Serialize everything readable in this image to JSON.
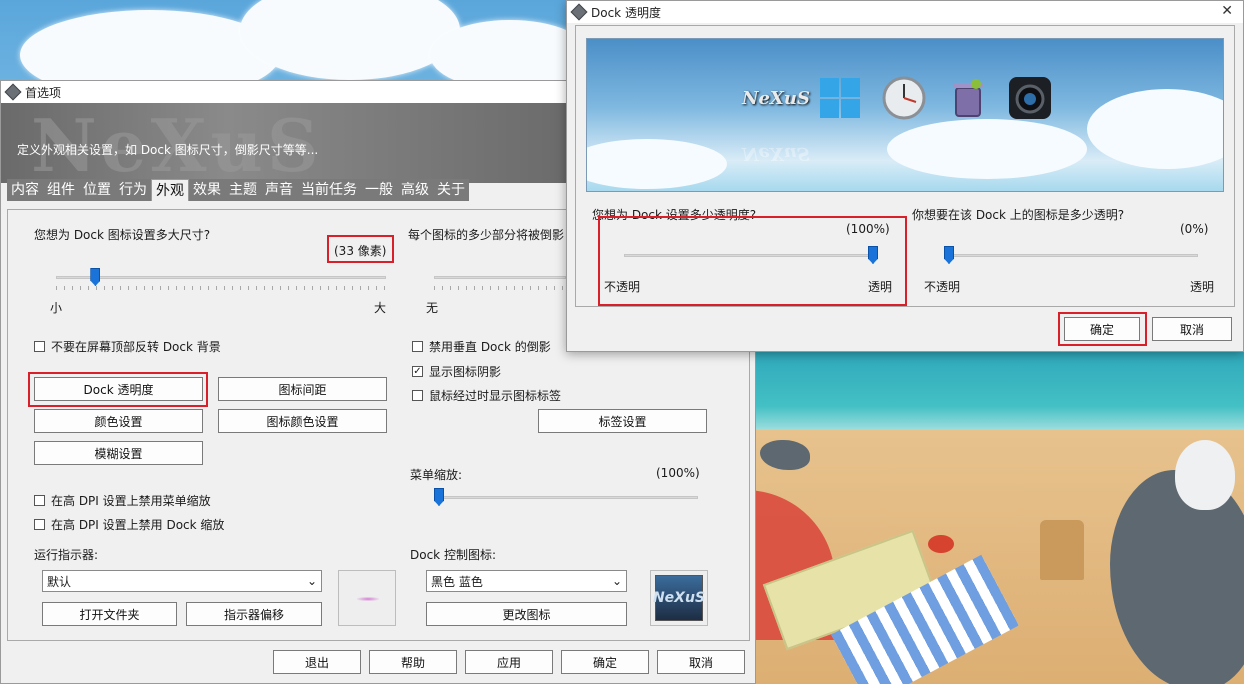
{
  "prefs": {
    "title": "首选项",
    "banner_logo": "NeXuS",
    "banner_text": "定义外观相关设置，如 Dock 图标尺寸，倒影尺寸等等...",
    "tabs": [
      "内容",
      "组件",
      "位置",
      "行为",
      "外观",
      "效果",
      "主题",
      "声音",
      "当前任务",
      "一般",
      "高级",
      "关于"
    ],
    "active_tab": "外观",
    "icon_size_question": "您想为 Dock 图标设置多大尺寸?",
    "icon_size_value": "(33 像素)",
    "icon_size_level": 0.12,
    "slider_min": "小",
    "slider_max": "大",
    "reflection_question": "每个图标的多少部分将被倒影",
    "reflection_min": "无",
    "chk_no_flip": "不要在屏幕顶部反转 Dock 背景",
    "btn_dock_transparency": "Dock 透明度",
    "btn_icon_spacing": "图标间距",
    "btn_color_settings": "颜色设置",
    "btn_icon_color": "图标颜色设置",
    "btn_blur_settings": "模糊设置",
    "chk_disable_vertical_reflection": "禁用垂直 Dock 的倒影",
    "chk_show_icon_shadow": "显示图标阴影",
    "chk_show_label_hover": "鼠标经过时显示图标标签",
    "btn_label_settings": "标签设置",
    "menu_zoom_label": "菜单缩放:",
    "menu_zoom_value": "(100%)",
    "menu_zoom_level": 0.0,
    "chk_dpi_menu": "在高 DPI 设置上禁用菜单缩放",
    "chk_dpi_dock": "在高 DPI 设置上禁用 Dock 缩放",
    "running_indicator_label": "运行指示器:",
    "running_indicator_value": "默认",
    "btn_open_folder": "打开文件夹",
    "btn_indicator_offset": "指示器偏移",
    "dock_control_icon_label": "Dock 控制图标:",
    "dock_control_icon_value": "黑色 蓝色",
    "btn_change_icon": "更改图标",
    "nexus_badge": "NeXuS",
    "footer": {
      "exit": "退出",
      "help": "帮助",
      "apply": "应用",
      "ok": "确定",
      "cancel": "取消"
    }
  },
  "dialog": {
    "title": "Dock 透明度",
    "close": "✕",
    "dock_logo": "NeXuS",
    "dock_logo_reflection": "NeXuS",
    "q_dock": "您想为 Dock 设置多少透明度?",
    "dock_value": "(100%)",
    "dock_level": 1.0,
    "q_icons": "你想要在该 Dock 上的图标是多少透明?",
    "icons_value": "(0%)",
    "icons_level": 0.0,
    "opaque": "不透明",
    "transparent": "透明",
    "ok": "确定",
    "cancel": "取消"
  },
  "colors": {
    "highlight": "#d9202a",
    "slider_thumb": "#1a73d9"
  }
}
